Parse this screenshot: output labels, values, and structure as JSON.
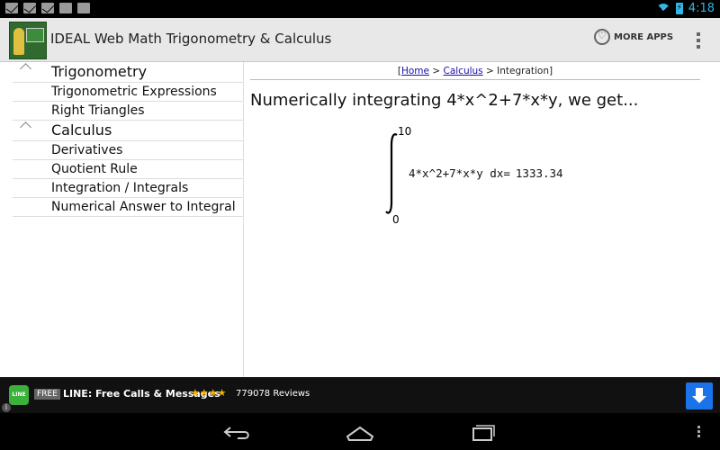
{
  "status_bar": {
    "time": "4:18",
    "icons": [
      "mail-icon",
      "mail-icon",
      "mail-icon",
      "facebook-icon",
      "game-icon",
      "wifi-icon",
      "battery-icon"
    ]
  },
  "action_bar": {
    "title": "IDEAL Web Math Trigonometry & Calculus",
    "more_apps_label": "MORE APPS"
  },
  "sidebar": {
    "groups": [
      {
        "label": "Trigonometry",
        "items": [
          "Trigonometric Expressions",
          "Right Triangles"
        ]
      },
      {
        "label": "Calculus",
        "items": [
          "Derivatives",
          "Quotient Rule",
          "Integration / Integrals",
          "Numerical Answer to Integral"
        ]
      }
    ]
  },
  "main": {
    "breadcrumb": {
      "open": "[",
      "home": "Home",
      "sep1": ">",
      "calculus": "Calculus",
      "sep2": ">",
      "current": "Integration",
      "close": "]"
    },
    "headline": "Numerically integrating 4*x^2+7*x*y, we get...",
    "integral": {
      "upper": "10",
      "lower": "0",
      "expression": "4*x^2+7*x*y dx=",
      "value": "1333.34"
    }
  },
  "ad": {
    "logo_text": "LINE",
    "free_tag": "FREE",
    "title": "LINE: Free Calls & Messages",
    "stars": "★★★★",
    "reviews": "779078 Reviews",
    "accent_color": "#1a73e8"
  },
  "colors": {
    "status_accent": "#33b5e5",
    "link": "#1a0dab"
  }
}
